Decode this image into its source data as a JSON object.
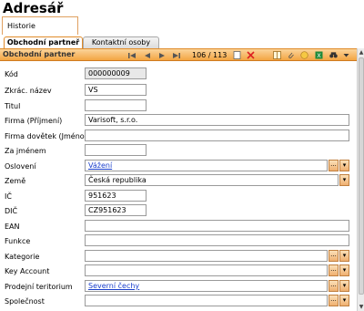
{
  "window": {
    "title": "Adresář"
  },
  "top_tab": {
    "label": "Historie komunikace"
  },
  "tabs": [
    {
      "label": "Obchodní partneř",
      "active": true
    },
    {
      "label": "Kontaktní osoby",
      "active": false
    }
  ],
  "toolbar": {
    "title": "Obchodní partner",
    "counter": "106 / 113",
    "icons": [
      "first-icon",
      "prev-icon",
      "next-icon",
      "last-icon",
      "new-icon",
      "delete-icon",
      "columns-icon",
      "attach-icon",
      "circle-icon",
      "export-icon",
      "binoculars-icon",
      "dropdown-icon"
    ]
  },
  "form": {
    "kod": {
      "label": "Kód",
      "value": "000000009"
    },
    "zkrac_nazev": {
      "label": "Zkrác. název",
      "value": "VS"
    },
    "titul": {
      "label": "Titul",
      "value": ""
    },
    "firma": {
      "label": "Firma (Příjmení)",
      "value": "Varisoft, s.r.o."
    },
    "firma_dovetek": {
      "label": "Firma dovětek (Jméno)",
      "value": ""
    },
    "za_jmenem": {
      "label": "Za jménem",
      "value": ""
    },
    "osloveni": {
      "label": "Oslovení",
      "value": "Vážení"
    },
    "zeme": {
      "label": "Země",
      "value": "Česká republika"
    },
    "ic": {
      "label": "IČ",
      "value": "951623"
    },
    "dic": {
      "label": "DIČ",
      "value": "CZ951623"
    },
    "ean": {
      "label": "EAN",
      "value": ""
    },
    "funkce": {
      "label": "Funkce",
      "value": ""
    },
    "kategorie": {
      "label": "Kategorie",
      "value": ""
    },
    "key_account": {
      "label": "Key Account",
      "value": ""
    },
    "prodejni_teritorium": {
      "label": "Prodejní teritorium",
      "value": "Severní čechy"
    },
    "spolecnost": {
      "label": "Společnost",
      "value": ""
    }
  },
  "symbols": {
    "ellipsis": "...",
    "dropdown": "▾"
  }
}
